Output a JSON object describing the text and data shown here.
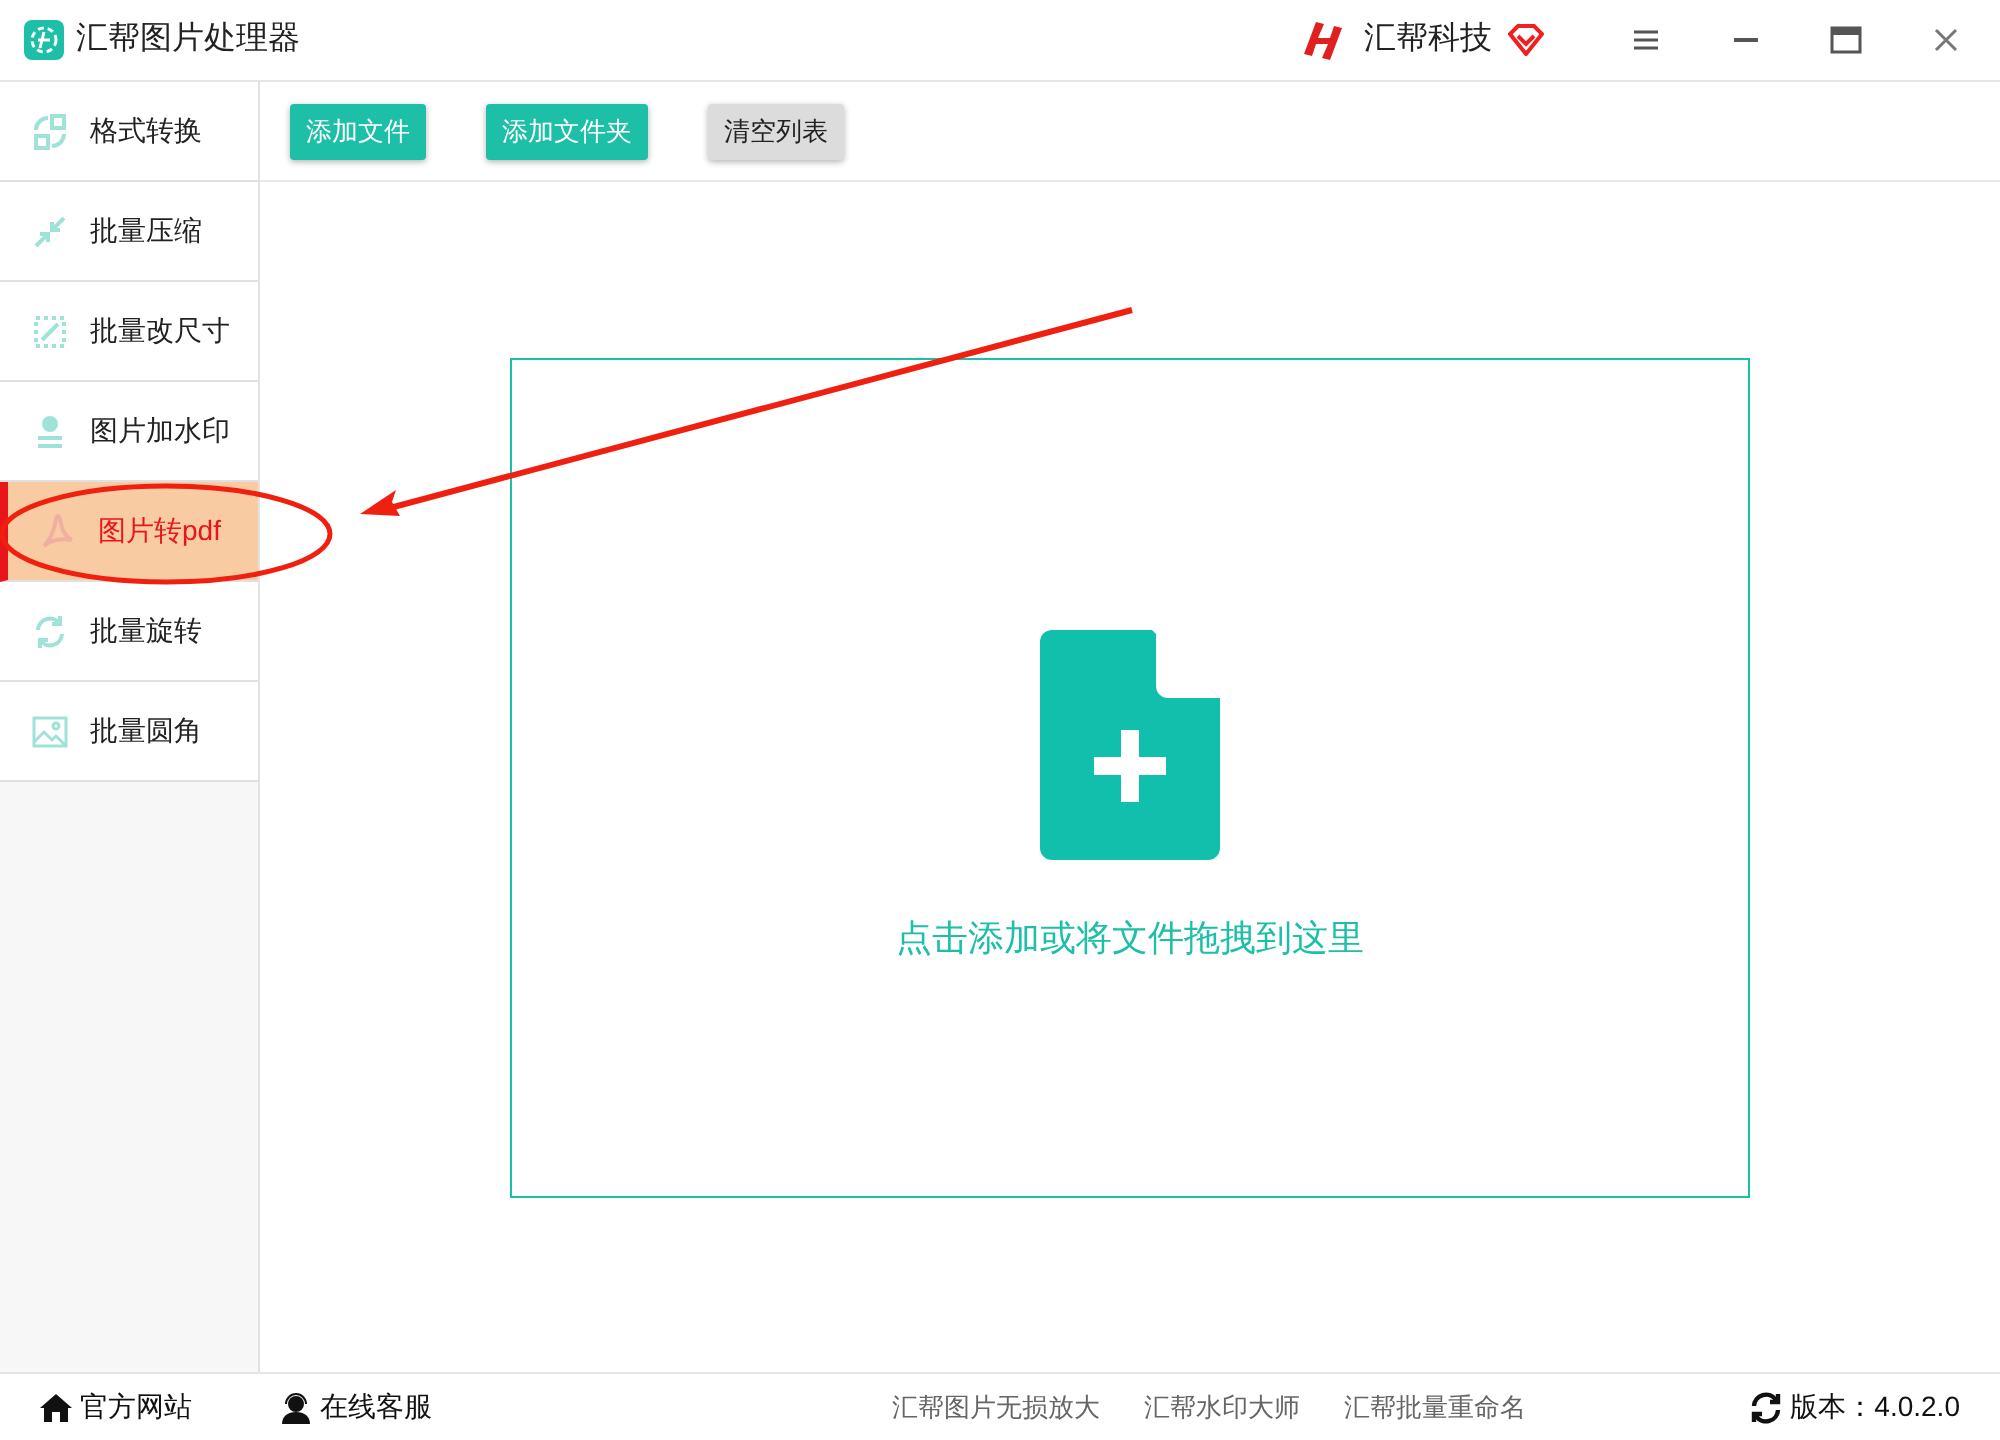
{
  "window": {
    "title": "汇帮图片处理器",
    "brand": "汇帮科技"
  },
  "sidebar": {
    "items": [
      {
        "label": "格式转换",
        "kind": "convert",
        "selected": false
      },
      {
        "label": "批量压缩",
        "kind": "compress",
        "selected": false
      },
      {
        "label": "批量改尺寸",
        "kind": "resize",
        "selected": false
      },
      {
        "label": "图片加水印",
        "kind": "stamp",
        "selected": false
      },
      {
        "label": "图片转pdf",
        "kind": "pdf",
        "selected": true
      },
      {
        "label": "批量旋转",
        "kind": "rotate",
        "selected": false
      },
      {
        "label": "批量圆角",
        "kind": "image",
        "selected": false
      }
    ]
  },
  "toolbar": {
    "buttons": [
      {
        "label": "添加文件",
        "kind": "primary"
      },
      {
        "label": "添加文件夹",
        "kind": "primary"
      },
      {
        "label": "清空列表",
        "kind": "secondary"
      }
    ]
  },
  "drop_area": {
    "hint": "点击添加或将文件拖拽到这里"
  },
  "status_bar": {
    "left": [
      {
        "label": "官方网站",
        "kind": "home"
      },
      {
        "label": "在线客服",
        "kind": "support"
      }
    ],
    "links": [
      "汇帮图片无损放大",
      "汇帮水印大师",
      "汇帮批量重命名"
    ],
    "version": "版本：4.0.2.0"
  }
}
